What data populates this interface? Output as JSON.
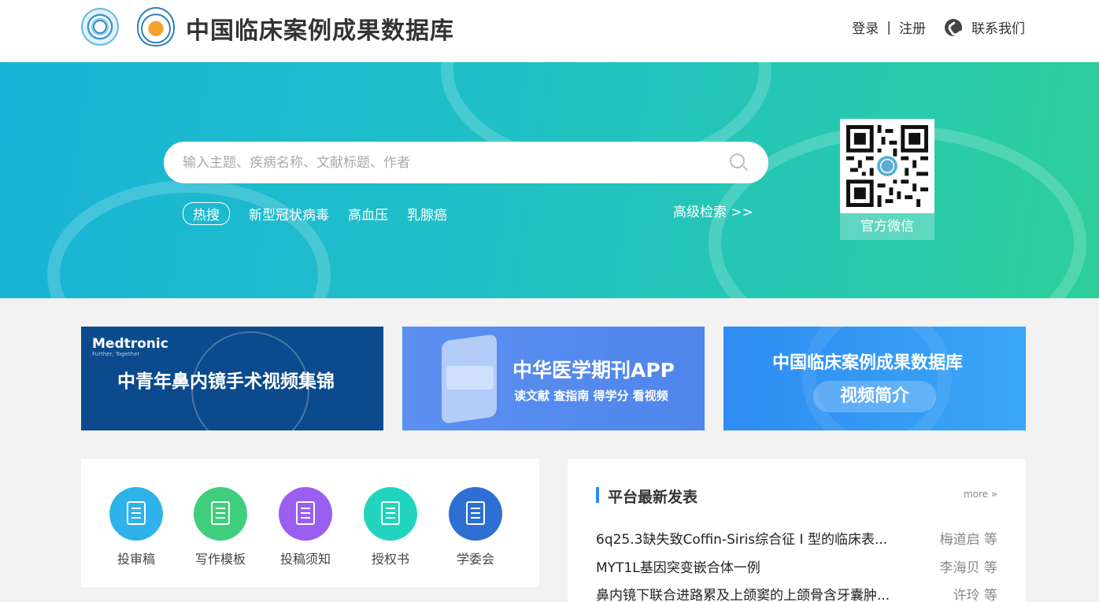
{
  "header": {
    "site_title": "中国临床案例成果数据库",
    "login": "登录",
    "separator": "|",
    "register": "注册",
    "contact": "联系我们"
  },
  "hero": {
    "search_placeholder": "输入主题、疾病名称、文献标题、作者",
    "hot_label": "热搜",
    "hot_terms": [
      "新型冠状病毒",
      "高血压",
      "乳腺癌"
    ],
    "advanced_search": "高级检索 >>",
    "qr_label": "官方微信"
  },
  "banners": [
    {
      "brand": "Medtronic",
      "tagline": "Further, Together",
      "title": "中青年鼻内镜手术视频集锦"
    },
    {
      "title": "中华医学期刊APP",
      "subtitle": "读文献 查指南 得学分 看视频"
    },
    {
      "title": "中国临床案例成果数据库",
      "pill": "视频简介"
    }
  ],
  "quick_links": [
    {
      "label": "投审稿",
      "color": "#2fb2ea",
      "icon": "review-icon"
    },
    {
      "label": "写作模板",
      "color": "#3fce7c",
      "icon": "edit-icon"
    },
    {
      "label": "投稿须知",
      "color": "#9a5ff0",
      "icon": "info-icon"
    },
    {
      "label": "授权书",
      "color": "#22d4bd",
      "icon": "certificate-icon"
    },
    {
      "label": "学委会",
      "color": "#2d6fd2",
      "icon": "committee-icon"
    }
  ],
  "latest": {
    "heading": "平台最新发表",
    "more": "more",
    "items": [
      {
        "title": "6q25.3缺失致Coffin-Siris综合征 I 型的临床表...",
        "author": "梅道启 等"
      },
      {
        "title": "MYT1L基因突变嵌合体一例",
        "author": "李海贝 等"
      },
      {
        "title": "鼻内镜下联合进路累及上颌窦的上颌骨含牙囊肿...",
        "author": "许玲 等"
      }
    ]
  },
  "colors": {
    "accent": "#2d8cf0",
    "hero_start": "#19b3d6",
    "hero_end": "#2dcf9a"
  }
}
